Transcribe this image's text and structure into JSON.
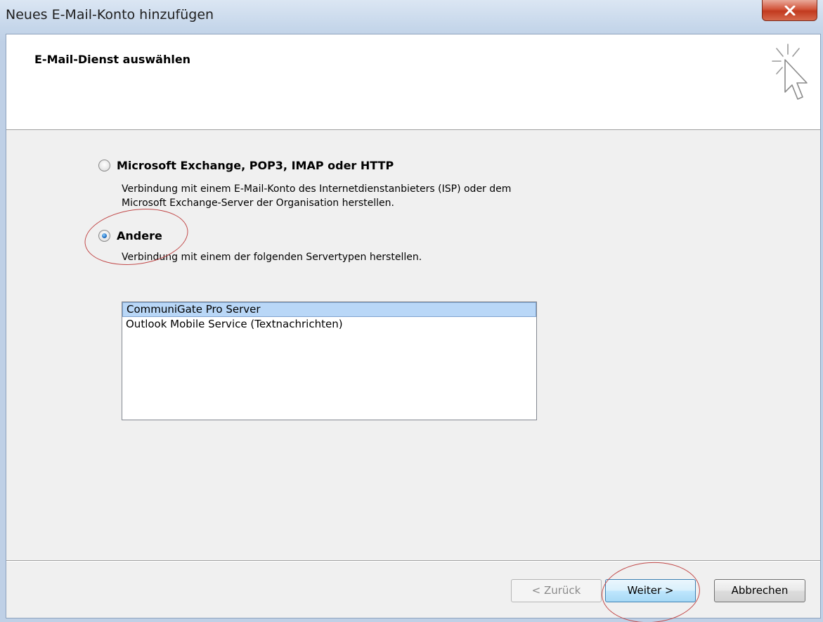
{
  "window": {
    "title": "Neues E-Mail-Konto hinzufügen",
    "close_label": "X"
  },
  "header": {
    "title": "E-Mail-Dienst auswählen",
    "icon": "wizard-cursor-icon"
  },
  "options": {
    "exchange": {
      "label": "Microsoft Exchange, POP3, IMAP oder HTTP",
      "description_line1": "Verbindung mit einem E-Mail-Konto des Internetdienstanbieters (ISP) oder dem",
      "description_line2": "Microsoft Exchange-Server der Organisation herstellen.",
      "checked": false
    },
    "other": {
      "label": "Andere",
      "description": "Verbindung mit einem der folgenden Servertypen herstellen.",
      "checked": true
    }
  },
  "server_types": {
    "items": [
      "CommuniGate Pro Server",
      "Outlook Mobile Service (Textnachrichten)"
    ],
    "selected": "CommuniGate Pro Server"
  },
  "buttons": {
    "back": "< Zurück",
    "next": "Weiter >",
    "cancel": "Abbrechen"
  },
  "colors": {
    "highlight_ellipse": "#c24a4a",
    "selection": "#b9d7f7"
  }
}
